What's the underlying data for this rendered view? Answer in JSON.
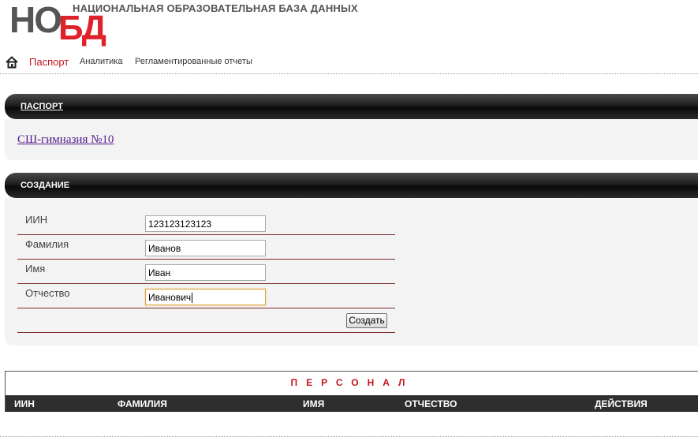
{
  "header": {
    "logo_nc": "НО",
    "logo_bd": "БД",
    "site_title": "НАЦИОНАЛЬНАЯ ОБРАЗОВАТЕЛЬНАЯ БАЗА ДАННЫХ"
  },
  "nav": {
    "home_icon": "home-icon",
    "items": [
      {
        "label": "Паспорт",
        "active": true
      },
      {
        "label": "Аналитика",
        "active": false
      },
      {
        "label": "Регламентированные отчеты",
        "active": false
      }
    ]
  },
  "passport": {
    "header": "ПАСПОРТ",
    "school_link": "СШ-гимназия №10"
  },
  "create": {
    "header": "СОЗДАНИЕ",
    "fields": [
      {
        "label": "ИИН",
        "value": "123123123123"
      },
      {
        "label": "Фамилия",
        "value": "Иванов"
      },
      {
        "label": "Имя",
        "value": "Иван"
      },
      {
        "label": "Отчество",
        "value": "Иванович"
      }
    ],
    "submit_label": "Создать"
  },
  "personnel": {
    "title": "ПЕРСОНАЛ",
    "columns": [
      "ИИН",
      "ФАМИЛИЯ",
      "ИМЯ",
      "ОТЧЕСТВО",
      "ДЕЙСТВИЯ"
    ]
  },
  "colors": {
    "accent_red": "#c0161e",
    "logo_red": "#e0202a",
    "header_bar": "#1e1e1e"
  }
}
